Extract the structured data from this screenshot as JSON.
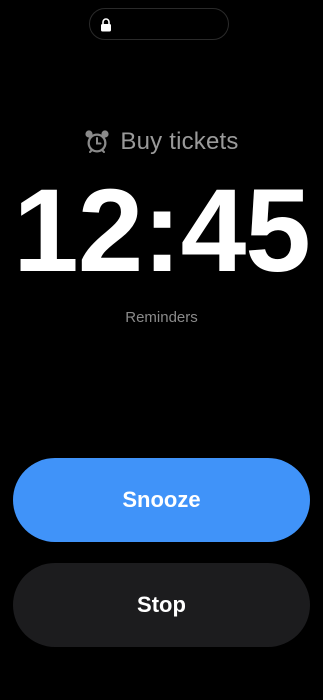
{
  "colors": {
    "background": "#000000",
    "accent": "#4093f9",
    "secondary_button": "#1c1c1e",
    "title_text": "#9a9a9a",
    "muted_text": "#8a8a8a"
  },
  "status_bar": {
    "icon": "lock-icon"
  },
  "alarm": {
    "icon": "alarm-clock-icon",
    "title": "Buy tickets",
    "time": "12:45",
    "source": "Reminders"
  },
  "actions": {
    "snooze_label": "Snooze",
    "stop_label": "Stop"
  }
}
